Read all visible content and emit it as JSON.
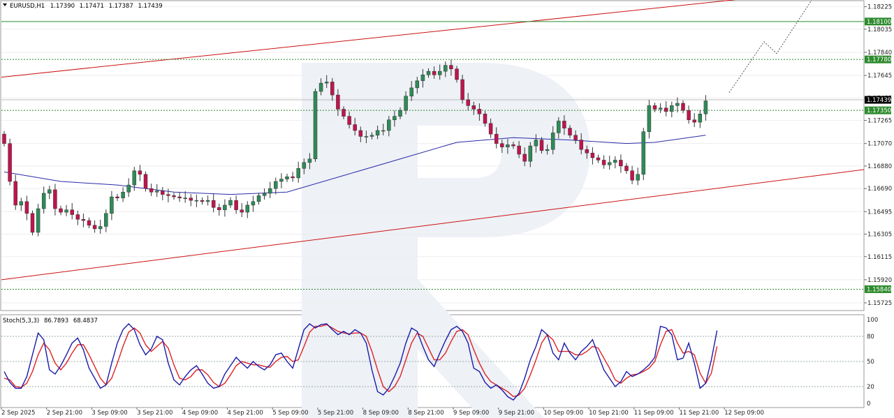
{
  "symbol_header": {
    "symbol": "EURUSD,H1",
    "open": "1.17390",
    "high": "1.17471",
    "low": "1.17387",
    "close": "1.17439"
  },
  "stoch_header": {
    "label": "Stoch(5,3,3)",
    "k": "86.7893",
    "d": "68.4837"
  },
  "price_axis_labels": [
    "1.18225",
    "1.18035",
    "1.17840",
    "1.17645",
    "1.17455",
    "1.17265",
    "1.17070",
    "1.16880",
    "1.16690",
    "1.16495",
    "1.16305",
    "1.16115",
    "1.15920",
    "1.15725"
  ],
  "stoch_axis_labels": [
    "100",
    "80",
    "50",
    "20",
    "0"
  ],
  "time_axis_labels": [
    "2 Sep 2025",
    "2 Sep 21:00",
    "3 Sep 09:00",
    "3 Sep 21:00",
    "4 Sep 09:00",
    "4 Sep 21:00",
    "5 Sep 09:00",
    "5 Sep 21:00",
    "8 Sep 09:00",
    "8 Sep 21:00",
    "9 Sep 09:00",
    "9 Sep 21:00",
    "10 Sep 09:00",
    "10 Sep 21:00",
    "11 Sep 09:00",
    "11 Sep 21:00",
    "12 Sep 09:00"
  ],
  "price_levels": [
    {
      "value": 1.181,
      "label": "1.18100",
      "color": "#2e8b2e",
      "style": "solid"
    },
    {
      "value": 1.1778,
      "label": "1.17780",
      "color": "#2e8b2e",
      "style": "dotted"
    },
    {
      "value": 1.1735,
      "label": "1.17350",
      "color": "#2e8b2e",
      "style": "dotted"
    },
    {
      "value": 1.1584,
      "label": "1.15840",
      "color": "#2e8b2e",
      "style": "dotted"
    }
  ],
  "current_price": {
    "value": 1.17439,
    "label": "1.17439",
    "color": "#000000"
  },
  "colors": {
    "bull": "#2e8b57",
    "bear": "#c0144c",
    "ma": "#2a2aa8",
    "channel": "#cc1111",
    "stoch_k": "#1a1aaa",
    "stoch_d": "#dd2222",
    "forecast": "#555555",
    "watermark": "#eef1f6"
  },
  "chart_data": {
    "type": "candlestick",
    "symbol": "EURUSD",
    "timeframe": "H1",
    "y_range": [
      1.1566,
      1.1827
    ],
    "candle_count": 125,
    "closes": [
      1.1707,
      1.1675,
      1.1655,
      1.1658,
      1.1648,
      1.1632,
      1.1652,
      1.1665,
      1.1668,
      1.1652,
      1.1649,
      1.1651,
      1.1647,
      1.1643,
      1.1642,
      1.1638,
      1.1635,
      1.1637,
      1.1648,
      1.1662,
      1.1661,
      1.1666,
      1.1672,
      1.1684,
      1.1681,
      1.1669,
      1.1666,
      1.1667,
      1.1664,
      1.1663,
      1.1662,
      1.1661,
      1.1661,
      1.1659,
      1.1659,
      1.1658,
      1.1659,
      1.1653,
      1.1651,
      1.1655,
      1.1659,
      1.1651,
      1.1649,
      1.1655,
      1.1658,
      1.1663,
      1.1665,
      1.1669,
      1.1675,
      1.1677,
      1.1679,
      1.1678,
      1.1686,
      1.1691,
      1.1694,
      1.1751,
      1.1758,
      1.1759,
      1.1748,
      1.1736,
      1.173,
      1.1723,
      1.1718,
      1.1713,
      1.1713,
      1.1714,
      1.1718,
      1.1718,
      1.1727,
      1.173,
      1.1735,
      1.1747,
      1.1754,
      1.176,
      1.1765,
      1.1768,
      1.1765,
      1.1768,
      1.1773,
      1.177,
      1.1761,
      1.1744,
      1.1739,
      1.1736,
      1.1732,
      1.1724,
      1.1715,
      1.1707,
      1.1704,
      1.1706,
      1.1705,
      1.1698,
      1.1692,
      1.1705,
      1.171,
      1.1701,
      1.1702,
      1.1716,
      1.1726,
      1.172,
      1.1714,
      1.171,
      1.1702,
      1.1699,
      1.1695,
      1.1693,
      1.1689,
      1.1691,
      1.1693,
      1.1688,
      1.1684,
      1.1676,
      1.1681,
      1.1717,
      1.1739,
      1.1736,
      1.1737,
      1.1734,
      1.1739,
      1.1741,
      1.1735,
      1.1727,
      1.1725,
      1.1732,
      1.1743
    ],
    "moving_average": [
      {
        "i": 0,
        "value": 1.1683
      },
      {
        "i": 10,
        "value": 1.1675
      },
      {
        "i": 20,
        "value": 1.1672
      },
      {
        "i": 30,
        "value": 1.1666
      },
      {
        "i": 40,
        "value": 1.1664
      },
      {
        "i": 50,
        "value": 1.1666
      },
      {
        "i": 60,
        "value": 1.168
      },
      {
        "i": 70,
        "value": 1.1694
      },
      {
        "i": 80,
        "value": 1.1708
      },
      {
        "i": 90,
        "value": 1.1712
      },
      {
        "i": 100,
        "value": 1.171
      },
      {
        "i": 110,
        "value": 1.1707
      },
      {
        "i": 115,
        "value": 1.1708
      },
      {
        "i": 124,
        "value": 1.1714
      }
    ],
    "channel_upper": {
      "from_value": 1.1763,
      "to_value": 1.1829,
      "slope_ref": "upper trendline"
    },
    "channel_lower": {
      "from_value": 1.1592,
      "to_value": 1.1685,
      "slope_ref": "lower trendline"
    },
    "forecast_path": [
      1.175,
      1.1793,
      1.1783,
      1.1828
    ],
    "stochastic": {
      "params": "5,3,3",
      "k": [
        38,
        25,
        18,
        18,
        32,
        58,
        84,
        76,
        40,
        35,
        45,
        58,
        72,
        78,
        64,
        42,
        30,
        18,
        22,
        48,
        72,
        88,
        95,
        88,
        70,
        58,
        65,
        80,
        76,
        48,
        28,
        22,
        32,
        40,
        45,
        35,
        24,
        18,
        20,
        35,
        45,
        55,
        48,
        42,
        50,
        44,
        40,
        46,
        58,
        60,
        50,
        42,
        65,
        88,
        95,
        90,
        94,
        95,
        88,
        82,
        86,
        82,
        88,
        84,
        72,
        40,
        14,
        10,
        18,
        32,
        48,
        72,
        90,
        86,
        68,
        52,
        44,
        60,
        75,
        88,
        92,
        86,
        72,
        42,
        38,
        25,
        18,
        22,
        16,
        8,
        4,
        12,
        30,
        52,
        68,
        88,
        82,
        60,
        52,
        72,
        60,
        52,
        62,
        68,
        76,
        58,
        40,
        30,
        20,
        26,
        38,
        32,
        35,
        40,
        46,
        55,
        92,
        90,
        82,
        52,
        54,
        72,
        48,
        18,
        24,
        52,
        87
      ],
      "d": [
        30,
        28,
        20,
        19,
        24,
        38,
        58,
        72,
        64,
        48,
        40,
        48,
        60,
        70,
        70,
        58,
        44,
        30,
        22,
        30,
        48,
        68,
        85,
        90,
        84,
        70,
        62,
        68,
        74,
        66,
        46,
        30,
        28,
        32,
        40,
        40,
        34,
        25,
        20,
        24,
        34,
        45,
        50,
        48,
        46,
        46,
        44,
        43,
        50,
        55,
        56,
        50,
        52,
        68,
        85,
        92,
        92,
        94,
        90,
        86,
        84,
        83,
        84,
        84,
        80,
        62,
        40,
        20,
        14,
        20,
        32,
        52,
        72,
        84,
        80,
        66,
        52,
        52,
        60,
        74,
        86,
        88,
        82,
        64,
        48,
        35,
        26,
        22,
        18,
        14,
        8,
        10,
        18,
        34,
        52,
        72,
        82,
        76,
        62,
        62,
        62,
        58,
        58,
        62,
        68,
        66,
        54,
        42,
        28,
        24,
        30,
        34,
        35,
        38,
        42,
        50,
        70,
        86,
        88,
        72,
        60,
        62,
        58,
        36,
        24,
        36,
        68
      ],
      "levels": [
        80,
        50,
        20
      ],
      "ylim": [
        0,
        100
      ]
    }
  }
}
